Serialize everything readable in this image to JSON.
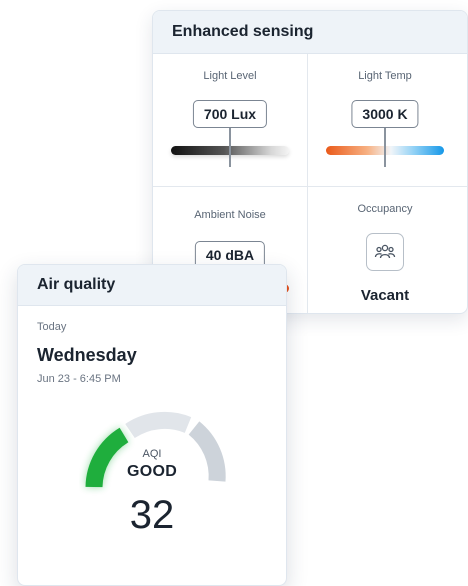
{
  "sensing": {
    "title": "Enhanced sensing",
    "light_level": {
      "label": "Light Level",
      "value": "700 Lux"
    },
    "light_temp": {
      "label": "Light Temp",
      "value": "3000 K"
    },
    "ambient_noise": {
      "label": "Ambient Noise",
      "value": "40 dBA"
    },
    "occupancy": {
      "label": "Occupancy",
      "status": "Vacant",
      "icon": "people-icon"
    }
  },
  "air_quality": {
    "title": "Air quality",
    "period": "Today",
    "day": "Wednesday",
    "datetime": "Jun 23 - 6:45 PM",
    "aqi_label": "AQI",
    "status": "GOOD",
    "value": "32",
    "colors": {
      "good": "#1fae3d",
      "track": "#d2d7de"
    }
  }
}
